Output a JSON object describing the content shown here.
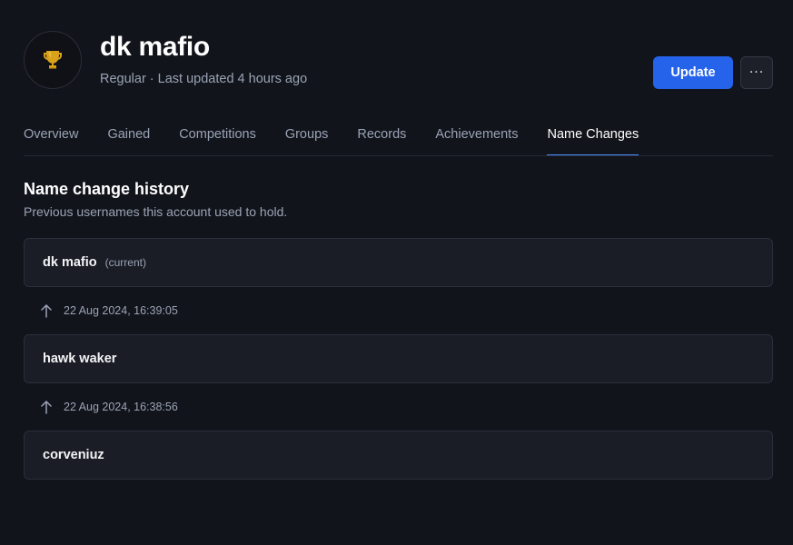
{
  "player": {
    "name": "dk mafio",
    "subtitle": "Regular · Last updated 4 hours ago",
    "avatar_icon": "trophy-icon"
  },
  "actions": {
    "update_label": "Update",
    "more_label": "···"
  },
  "tabs": [
    {
      "label": "Overview",
      "active": false
    },
    {
      "label": "Gained",
      "active": false
    },
    {
      "label": "Competitions",
      "active": false
    },
    {
      "label": "Groups",
      "active": false
    },
    {
      "label": "Records",
      "active": false
    },
    {
      "label": "Achievements",
      "active": false
    },
    {
      "label": "Name Changes",
      "active": true
    }
  ],
  "section": {
    "title": "Name change history",
    "description": "Previous usernames this account used to hold."
  },
  "history": {
    "names": [
      {
        "name": "dk mafio",
        "tag": "(current)"
      },
      {
        "name": "hawk waker",
        "tag": ""
      },
      {
        "name": "corveniuz",
        "tag": ""
      }
    ],
    "changes": [
      {
        "date": "22 Aug 2024, 16:39:05",
        "icon": "arrow-up-icon"
      },
      {
        "date": "22 Aug 2024, 16:38:56",
        "icon": "arrow-up-icon"
      }
    ]
  },
  "colors": {
    "background": "#12141b",
    "accent": "#2563eb",
    "tab_underline": "#4c8dff",
    "muted_text": "#9aa3b5",
    "card_background": "#1a1d25",
    "trophy_gold": "#d9a21b"
  }
}
